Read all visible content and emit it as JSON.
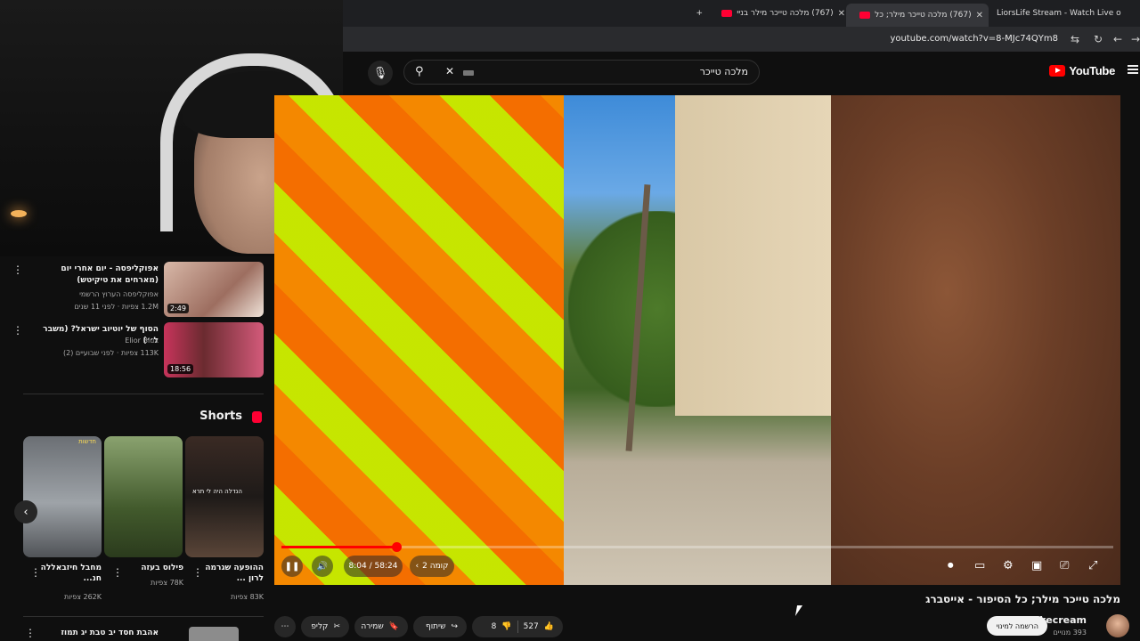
{
  "browser": {
    "tabs": [
      {
        "title": "LiorsLife Stream - Watch Live o",
        "active": false
      },
      {
        "title": "(767) מלכה טייכר מילר; כל",
        "active": true
      },
      {
        "title": "(767) מלכה טייכר מילר בניי",
        "active": false
      }
    ],
    "new_tab_label": "+",
    "url": "youtube.com/watch?v=8-MJc74QYm8"
  },
  "youtube": {
    "logo_text": "YouTube",
    "search": {
      "query": "מלכה טייכר"
    }
  },
  "player": {
    "time_label": "8:04 / 58:24",
    "chapter_label": "קומה 2",
    "progress": 0.138
  },
  "video": {
    "title": "מלכה טייכר מילר; כל הסיפור - אייסברג",
    "channel": "Sikecream",
    "subscribers": "393 מנויים",
    "subscribe_label": "הרשמה למינוי",
    "likes": "527",
    "dislikes": "8",
    "share_label": "שיתוף",
    "save_label": "שמירה",
    "clip_label": "קליפ"
  },
  "sidebar": {
    "recommendations": [
      {
        "title": "אפוקליפסה - יום אחרי יום (מארחים את טיקיטש)",
        "channel": "אפוקליפסה הערוץ הרשמי",
        "meta": "1.2M צפיות · לפני 11 שנים",
        "duration": "2:49"
      },
      {
        "title": "הסוף של יוטיוב ישראל? (משבר ל׳׳)",
        "channel": "Elior Blux",
        "meta": "113K צפיות · לפני שבועיים (2)",
        "duration": "18:56"
      }
    ],
    "shorts_title": "Shorts",
    "shorts": [
      {
        "title": "ההופעה שגרמה לרון ...",
        "views": "83K צפיות",
        "overlay": "הנדלה היה לי תרא"
      },
      {
        "title": "פילוס בעזה",
        "views": "78K צפיות",
        "overlay": ""
      },
      {
        "title": "מחבל חיזבאללה חנ...",
        "views": "262K צפיות",
        "overlay": "חדשות"
      }
    ],
    "bottom_item_title": "אהבת חסד יב טבת יג תמוז"
  },
  "colors": {
    "accent": "#ff0000",
    "background": "#0f0f0f",
    "surface": "#272727"
  }
}
